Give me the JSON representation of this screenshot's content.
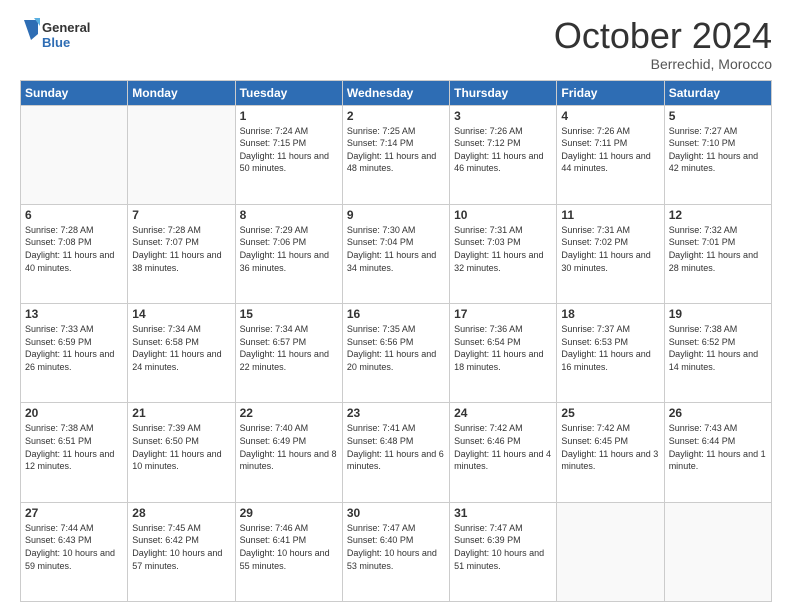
{
  "header": {
    "logo_line1": "General",
    "logo_line2": "Blue",
    "month": "October 2024",
    "location": "Berrechid, Morocco"
  },
  "days_of_week": [
    "Sunday",
    "Monday",
    "Tuesday",
    "Wednesday",
    "Thursday",
    "Friday",
    "Saturday"
  ],
  "weeks": [
    [
      {
        "day": "",
        "sunrise": "",
        "sunset": "",
        "daylight": ""
      },
      {
        "day": "",
        "sunrise": "",
        "sunset": "",
        "daylight": ""
      },
      {
        "day": "1",
        "sunrise": "Sunrise: 7:24 AM",
        "sunset": "Sunset: 7:15 PM",
        "daylight": "Daylight: 11 hours and 50 minutes."
      },
      {
        "day": "2",
        "sunrise": "Sunrise: 7:25 AM",
        "sunset": "Sunset: 7:14 PM",
        "daylight": "Daylight: 11 hours and 48 minutes."
      },
      {
        "day": "3",
        "sunrise": "Sunrise: 7:26 AM",
        "sunset": "Sunset: 7:12 PM",
        "daylight": "Daylight: 11 hours and 46 minutes."
      },
      {
        "day": "4",
        "sunrise": "Sunrise: 7:26 AM",
        "sunset": "Sunset: 7:11 PM",
        "daylight": "Daylight: 11 hours and 44 minutes."
      },
      {
        "day": "5",
        "sunrise": "Sunrise: 7:27 AM",
        "sunset": "Sunset: 7:10 PM",
        "daylight": "Daylight: 11 hours and 42 minutes."
      }
    ],
    [
      {
        "day": "6",
        "sunrise": "Sunrise: 7:28 AM",
        "sunset": "Sunset: 7:08 PM",
        "daylight": "Daylight: 11 hours and 40 minutes."
      },
      {
        "day": "7",
        "sunrise": "Sunrise: 7:28 AM",
        "sunset": "Sunset: 7:07 PM",
        "daylight": "Daylight: 11 hours and 38 minutes."
      },
      {
        "day": "8",
        "sunrise": "Sunrise: 7:29 AM",
        "sunset": "Sunset: 7:06 PM",
        "daylight": "Daylight: 11 hours and 36 minutes."
      },
      {
        "day": "9",
        "sunrise": "Sunrise: 7:30 AM",
        "sunset": "Sunset: 7:04 PM",
        "daylight": "Daylight: 11 hours and 34 minutes."
      },
      {
        "day": "10",
        "sunrise": "Sunrise: 7:31 AM",
        "sunset": "Sunset: 7:03 PM",
        "daylight": "Daylight: 11 hours and 32 minutes."
      },
      {
        "day": "11",
        "sunrise": "Sunrise: 7:31 AM",
        "sunset": "Sunset: 7:02 PM",
        "daylight": "Daylight: 11 hours and 30 minutes."
      },
      {
        "day": "12",
        "sunrise": "Sunrise: 7:32 AM",
        "sunset": "Sunset: 7:01 PM",
        "daylight": "Daylight: 11 hours and 28 minutes."
      }
    ],
    [
      {
        "day": "13",
        "sunrise": "Sunrise: 7:33 AM",
        "sunset": "Sunset: 6:59 PM",
        "daylight": "Daylight: 11 hours and 26 minutes."
      },
      {
        "day": "14",
        "sunrise": "Sunrise: 7:34 AM",
        "sunset": "Sunset: 6:58 PM",
        "daylight": "Daylight: 11 hours and 24 minutes."
      },
      {
        "day": "15",
        "sunrise": "Sunrise: 7:34 AM",
        "sunset": "Sunset: 6:57 PM",
        "daylight": "Daylight: 11 hours and 22 minutes."
      },
      {
        "day": "16",
        "sunrise": "Sunrise: 7:35 AM",
        "sunset": "Sunset: 6:56 PM",
        "daylight": "Daylight: 11 hours and 20 minutes."
      },
      {
        "day": "17",
        "sunrise": "Sunrise: 7:36 AM",
        "sunset": "Sunset: 6:54 PM",
        "daylight": "Daylight: 11 hours and 18 minutes."
      },
      {
        "day": "18",
        "sunrise": "Sunrise: 7:37 AM",
        "sunset": "Sunset: 6:53 PM",
        "daylight": "Daylight: 11 hours and 16 minutes."
      },
      {
        "day": "19",
        "sunrise": "Sunrise: 7:38 AM",
        "sunset": "Sunset: 6:52 PM",
        "daylight": "Daylight: 11 hours and 14 minutes."
      }
    ],
    [
      {
        "day": "20",
        "sunrise": "Sunrise: 7:38 AM",
        "sunset": "Sunset: 6:51 PM",
        "daylight": "Daylight: 11 hours and 12 minutes."
      },
      {
        "day": "21",
        "sunrise": "Sunrise: 7:39 AM",
        "sunset": "Sunset: 6:50 PM",
        "daylight": "Daylight: 11 hours and 10 minutes."
      },
      {
        "day": "22",
        "sunrise": "Sunrise: 7:40 AM",
        "sunset": "Sunset: 6:49 PM",
        "daylight": "Daylight: 11 hours and 8 minutes."
      },
      {
        "day": "23",
        "sunrise": "Sunrise: 7:41 AM",
        "sunset": "Sunset: 6:48 PM",
        "daylight": "Daylight: 11 hours and 6 minutes."
      },
      {
        "day": "24",
        "sunrise": "Sunrise: 7:42 AM",
        "sunset": "Sunset: 6:46 PM",
        "daylight": "Daylight: 11 hours and 4 minutes."
      },
      {
        "day": "25",
        "sunrise": "Sunrise: 7:42 AM",
        "sunset": "Sunset: 6:45 PM",
        "daylight": "Daylight: 11 hours and 3 minutes."
      },
      {
        "day": "26",
        "sunrise": "Sunrise: 7:43 AM",
        "sunset": "Sunset: 6:44 PM",
        "daylight": "Daylight: 11 hours and 1 minute."
      }
    ],
    [
      {
        "day": "27",
        "sunrise": "Sunrise: 7:44 AM",
        "sunset": "Sunset: 6:43 PM",
        "daylight": "Daylight: 10 hours and 59 minutes."
      },
      {
        "day": "28",
        "sunrise": "Sunrise: 7:45 AM",
        "sunset": "Sunset: 6:42 PM",
        "daylight": "Daylight: 10 hours and 57 minutes."
      },
      {
        "day": "29",
        "sunrise": "Sunrise: 7:46 AM",
        "sunset": "Sunset: 6:41 PM",
        "daylight": "Daylight: 10 hours and 55 minutes."
      },
      {
        "day": "30",
        "sunrise": "Sunrise: 7:47 AM",
        "sunset": "Sunset: 6:40 PM",
        "daylight": "Daylight: 10 hours and 53 minutes."
      },
      {
        "day": "31",
        "sunrise": "Sunrise: 7:47 AM",
        "sunset": "Sunset: 6:39 PM",
        "daylight": "Daylight: 10 hours and 51 minutes."
      },
      {
        "day": "",
        "sunrise": "",
        "sunset": "",
        "daylight": ""
      },
      {
        "day": "",
        "sunrise": "",
        "sunset": "",
        "daylight": ""
      }
    ]
  ]
}
